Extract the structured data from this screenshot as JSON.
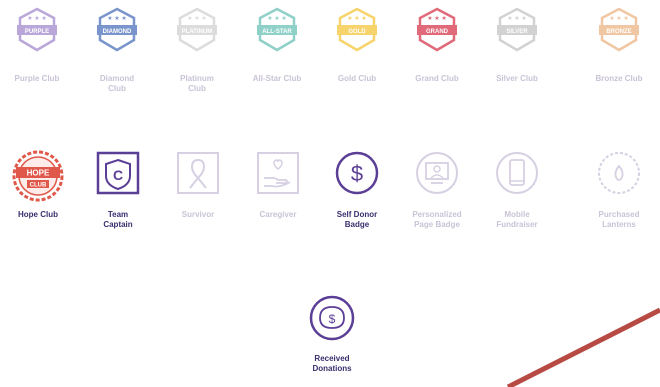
{
  "row1": [
    {
      "id": "purple",
      "label": "Purple Club",
      "ribbon": "PURPLE",
      "color": "#b9a7d9"
    },
    {
      "id": "diamond",
      "label": "Diamond\nClub",
      "ribbon": "DIAMOND",
      "color": "#7a95cc"
    },
    {
      "id": "platinum",
      "label": "Platinum\nClub",
      "ribbon": "PLATINUM",
      "color": "#dcdcdc"
    },
    {
      "id": "allstar",
      "label": "All-Star Club",
      "ribbon": "ALL-STAR",
      "color": "#8fd0c8"
    },
    {
      "id": "gold",
      "label": "Gold Club",
      "ribbon": "GOLD",
      "color": "#f6d36b"
    },
    {
      "id": "grand",
      "label": "Grand Club",
      "ribbon": "GRAND",
      "color": "#e06a7a"
    },
    {
      "id": "silver",
      "label": "Silver Club",
      "ribbon": "SILVER",
      "color": "#d2d2d2"
    },
    {
      "id": "bronze",
      "label": "Bronze Club",
      "ribbon": "BRONZE",
      "color": "#f0c7a2"
    }
  ],
  "row2": [
    {
      "id": "hope",
      "label": "Hope Club",
      "active": true,
      "icon": "hope-club-icon",
      "hope_top": "HOPE",
      "hope_bottom": "CLUB"
    },
    {
      "id": "captain",
      "label": "Team\nCaptain",
      "active": true,
      "icon": "shield-c-icon",
      "glyph": "C"
    },
    {
      "id": "survivor",
      "label": "Survivor",
      "active": false,
      "icon": "ribbon-icon"
    },
    {
      "id": "caregiver",
      "label": "Caregiver",
      "active": false,
      "icon": "heart-hand-icon"
    },
    {
      "id": "selfdonor",
      "label": "Self Donor\nBadge",
      "active": true,
      "icon": "dollar-circle-icon",
      "glyph": "$"
    },
    {
      "id": "personal",
      "label": "Personalized\nPage Badge",
      "active": false,
      "icon": "monitor-user-icon"
    },
    {
      "id": "mobile",
      "label": "Mobile\nFundraiser",
      "active": false,
      "icon": "smartphone-icon"
    },
    {
      "id": "lantern",
      "label": "Purchased\nLanterns",
      "active": false,
      "icon": "lantern-flame-icon"
    }
  ],
  "received": {
    "label": "Received\nDonations",
    "active": true,
    "icon": "piggy-bank-icon",
    "glyph": "$"
  },
  "colors": {
    "active_stroke": "#5b3f96",
    "active_text": "#3a2e6e",
    "inactive_stroke": "#d6d0e2",
    "inactive_text": "#c9c3d6",
    "hope_red": "#e0584a",
    "slash": "#b84a44"
  }
}
